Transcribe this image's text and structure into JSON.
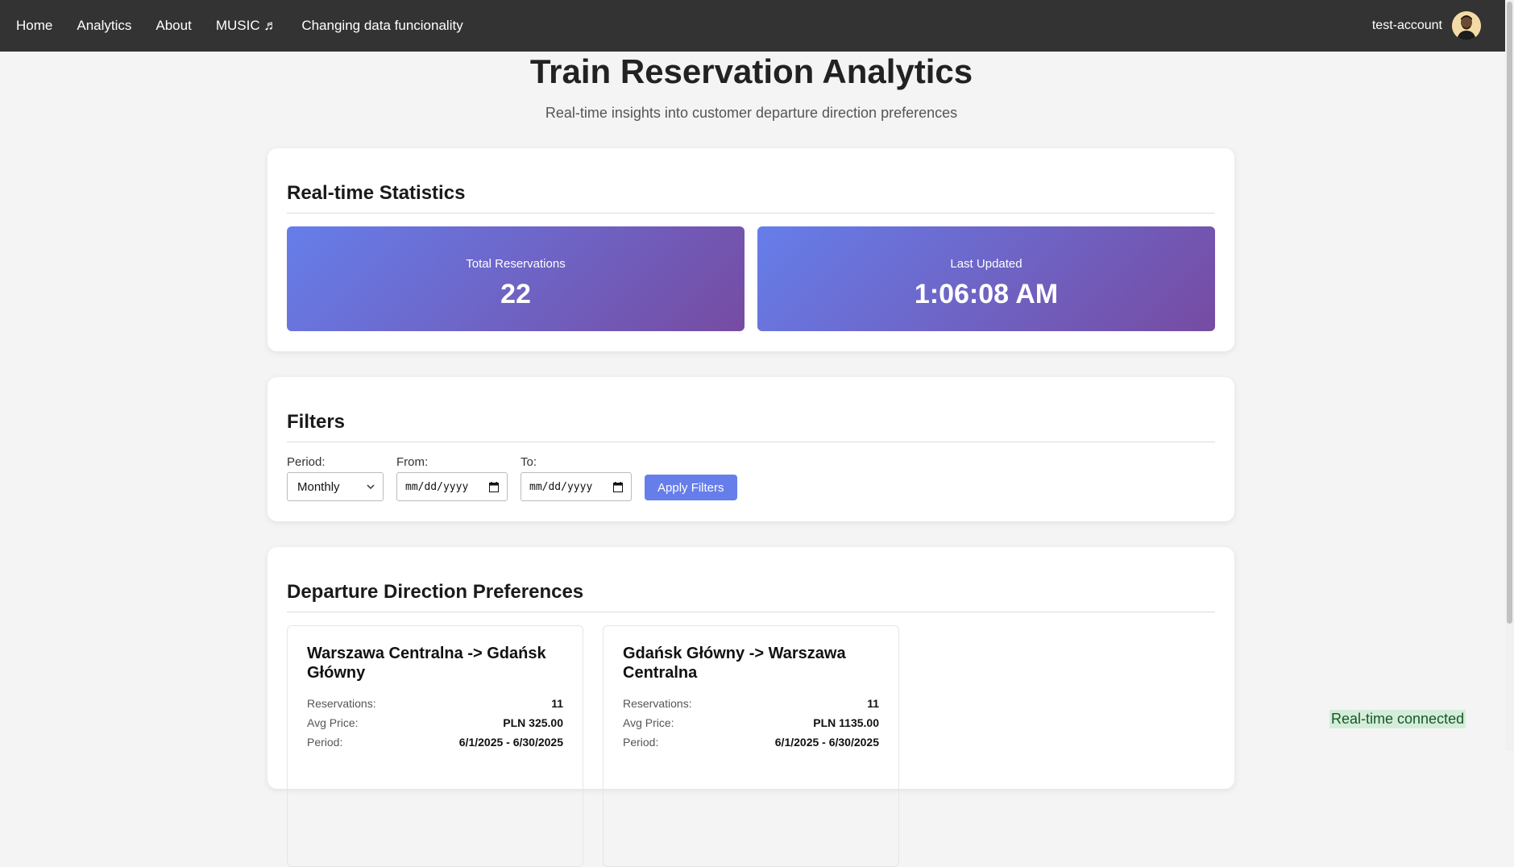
{
  "nav": {
    "links": [
      "Home",
      "Analytics",
      "About",
      "MUSIC ♬",
      "Changing data funcionality"
    ],
    "username": "test-account"
  },
  "header": {
    "title": "Train Reservation Analytics",
    "subtitle": "Real-time insights into customer departure direction preferences"
  },
  "stats": {
    "heading": "Real-time Statistics",
    "tiles": [
      {
        "label": "Total Reservations",
        "value": "22"
      },
      {
        "label": "Last Updated",
        "value": "1:06:08 AM"
      }
    ]
  },
  "filters": {
    "heading": "Filters",
    "period_label": "Period:",
    "period_value": "Monthly",
    "from_label": "From:",
    "from_placeholder": "mm/dd/yyyy",
    "to_label": "To:",
    "to_placeholder": "mm/dd/yyyy",
    "apply_label": "Apply Filters"
  },
  "preferences": {
    "heading": "Departure Direction Preferences",
    "items": [
      {
        "title": "Warszawa Centralna -> Gdańsk Główny",
        "reservations_label": "Reservations:",
        "reservations": "11",
        "avg_price_label": "Avg Price:",
        "avg_price": "PLN 325.00",
        "period_label": "Period:",
        "period": "6/1/2025 - 6/30/2025"
      },
      {
        "title": "Gdańsk Główny -> Warszawa Centralna",
        "reservations_label": "Reservations:",
        "reservations": "11",
        "avg_price_label": "Avg Price:",
        "avg_price": "PLN 1135.00",
        "period_label": "Period:",
        "period": "6/1/2025 - 6/30/2025"
      }
    ]
  },
  "status": {
    "realtime": "Real-time connected"
  },
  "colors": {
    "navbar": "#333333",
    "accent_start": "#667eea",
    "accent_end": "#764ba2",
    "status_bg": "#d4edda",
    "status_text": "#155724"
  }
}
